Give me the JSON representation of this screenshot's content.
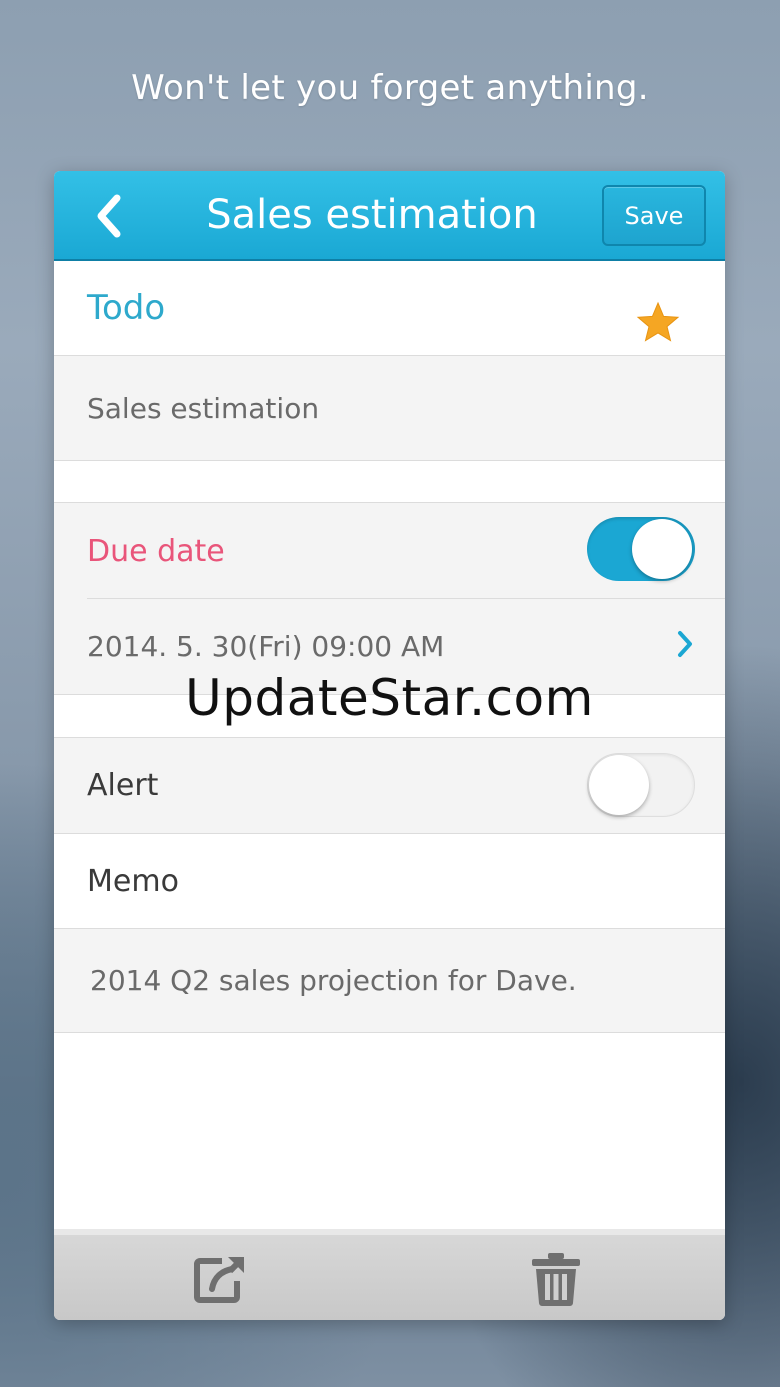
{
  "tagline": "Won't let you forget anything.",
  "header": {
    "title": "Sales estimation",
    "save_label": "Save",
    "accent_color": "#1ba7d3"
  },
  "todo": {
    "section_label": "Todo",
    "starred": true,
    "star_color": "#f5a623",
    "title_value": "Sales estimation"
  },
  "due_date": {
    "label": "Due date",
    "label_color": "#e9557a",
    "enabled": true,
    "value": "2014. 5. 30(Fri) 09:00 AM"
  },
  "alert": {
    "label": "Alert",
    "enabled": false
  },
  "memo": {
    "label": "Memo",
    "value": "2014 Q2 sales projection for Dave."
  },
  "watermark": "UpdateStar.com",
  "toolbar": {
    "share_icon": "share-icon",
    "delete_icon": "trash-icon"
  }
}
